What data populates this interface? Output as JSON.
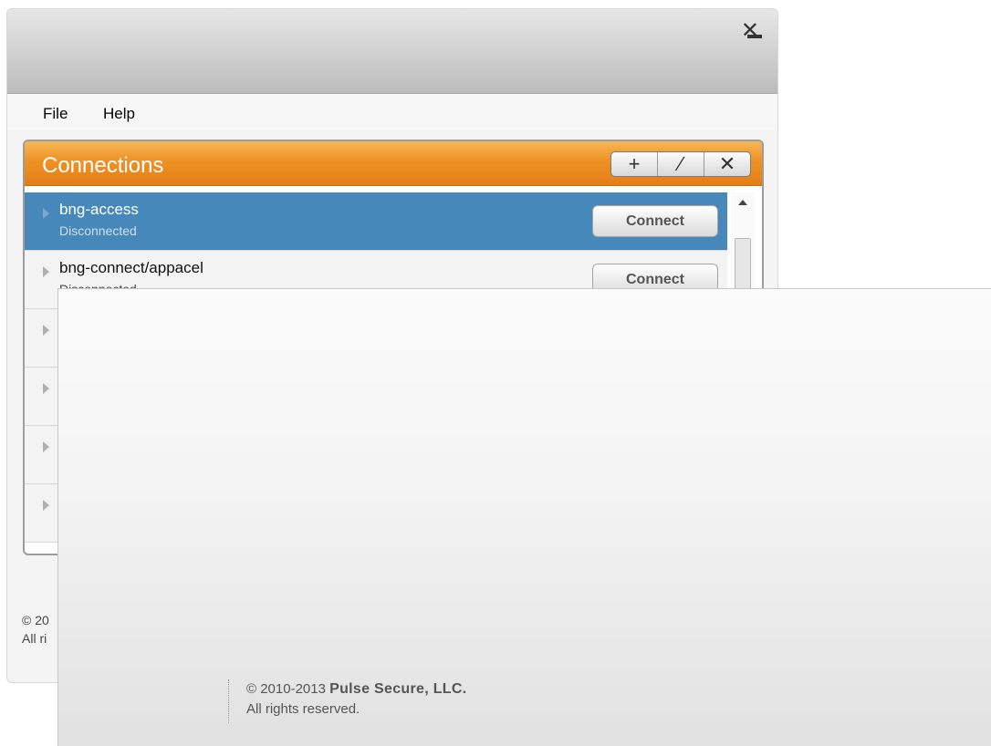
{
  "window": {
    "minimize_glyph": "",
    "close_glyph": "✕"
  },
  "menu": {
    "file": "File",
    "help": "Help"
  },
  "connections": {
    "title": "Connections",
    "add_glyph": "+",
    "edit_glyph": "∕",
    "delete_glyph": "✕",
    "rows": [
      {
        "name": "bng-access",
        "status": "Disconnected",
        "button": "Connect",
        "selected": true
      },
      {
        "name": "bng-connect/appacel",
        "status": "Disconnected",
        "button": "Connect",
        "selected": false
      }
    ]
  },
  "back_footer": {
    "copyright_fragment": "© 20",
    "rights_fragment": "All ri"
  },
  "splash": {
    "copyright_prefix": "© 2010-2013",
    "company": "Pulse Secure, LLC.",
    "rights": "All rights reserved."
  }
}
